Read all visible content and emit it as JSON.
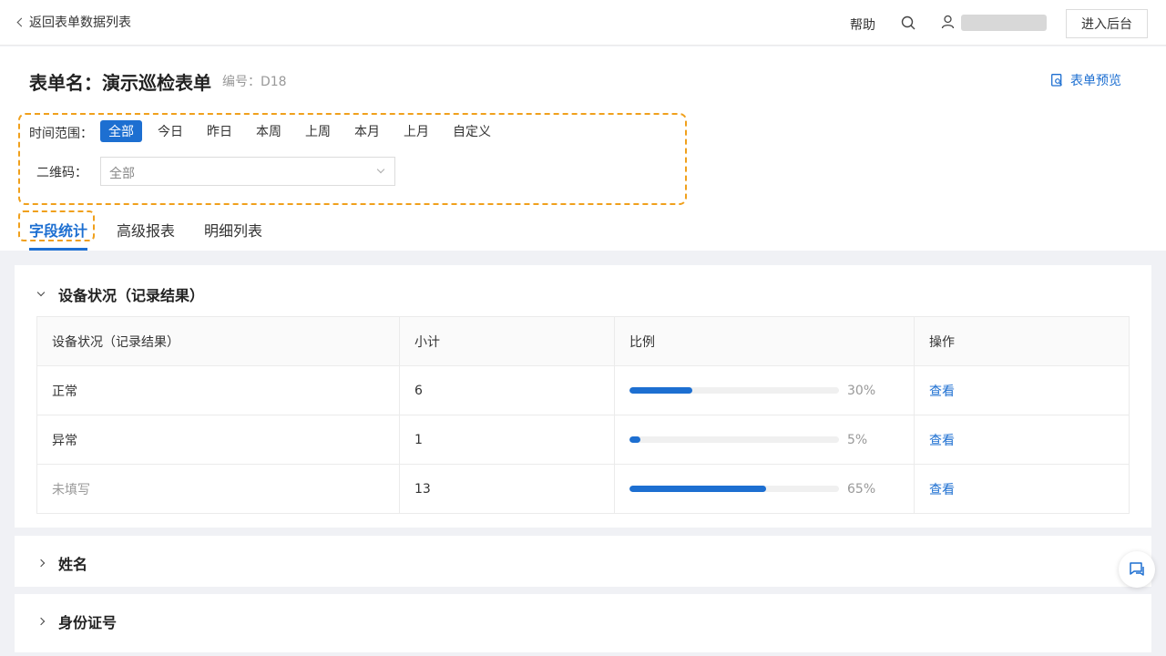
{
  "topbar": {
    "back_label": "返回表单数据列表",
    "help_label": "帮助",
    "admin_label": "进入后台"
  },
  "header": {
    "title": "表单名：演示巡检表单",
    "code": "编号：D18",
    "preview_label": "表单预览"
  },
  "filters": {
    "time_label": "时间范围：",
    "time_options": [
      "全部",
      "今日",
      "昨日",
      "本周",
      "上周",
      "本月",
      "上月",
      "自定义"
    ],
    "time_selected": "全部",
    "qr_label": "二维码：",
    "qr_value": "全部"
  },
  "tabs": [
    "字段统计",
    "高级报表",
    "明细列表"
  ],
  "active_tab": "字段统计",
  "section1": {
    "title": "设备状况（记录结果）",
    "columns": [
      "设备状况（记录结果）",
      "小计",
      "比例",
      "操作"
    ],
    "rows": [
      {
        "label": "正常",
        "count": "6",
        "ratio": 0.3,
        "pct": "30%",
        "action": "查看"
      },
      {
        "label": "异常",
        "count": "1",
        "ratio": 0.05,
        "pct": "5%",
        "action": "查看"
      },
      {
        "label": "未填写",
        "count": "13",
        "ratio": 0.65,
        "pct": "65%",
        "action": "查看"
      }
    ]
  },
  "section2": {
    "title": "姓名"
  },
  "section3": {
    "title": "身份证号"
  },
  "colors": {
    "accent": "#1d6fd1",
    "highlight": "#f0a01c"
  },
  "icons": [
    "chevron-left-icon",
    "search-icon",
    "user-icon",
    "preview-icon",
    "chevron-down-icon",
    "chevron-right-icon",
    "chat-icon"
  ]
}
